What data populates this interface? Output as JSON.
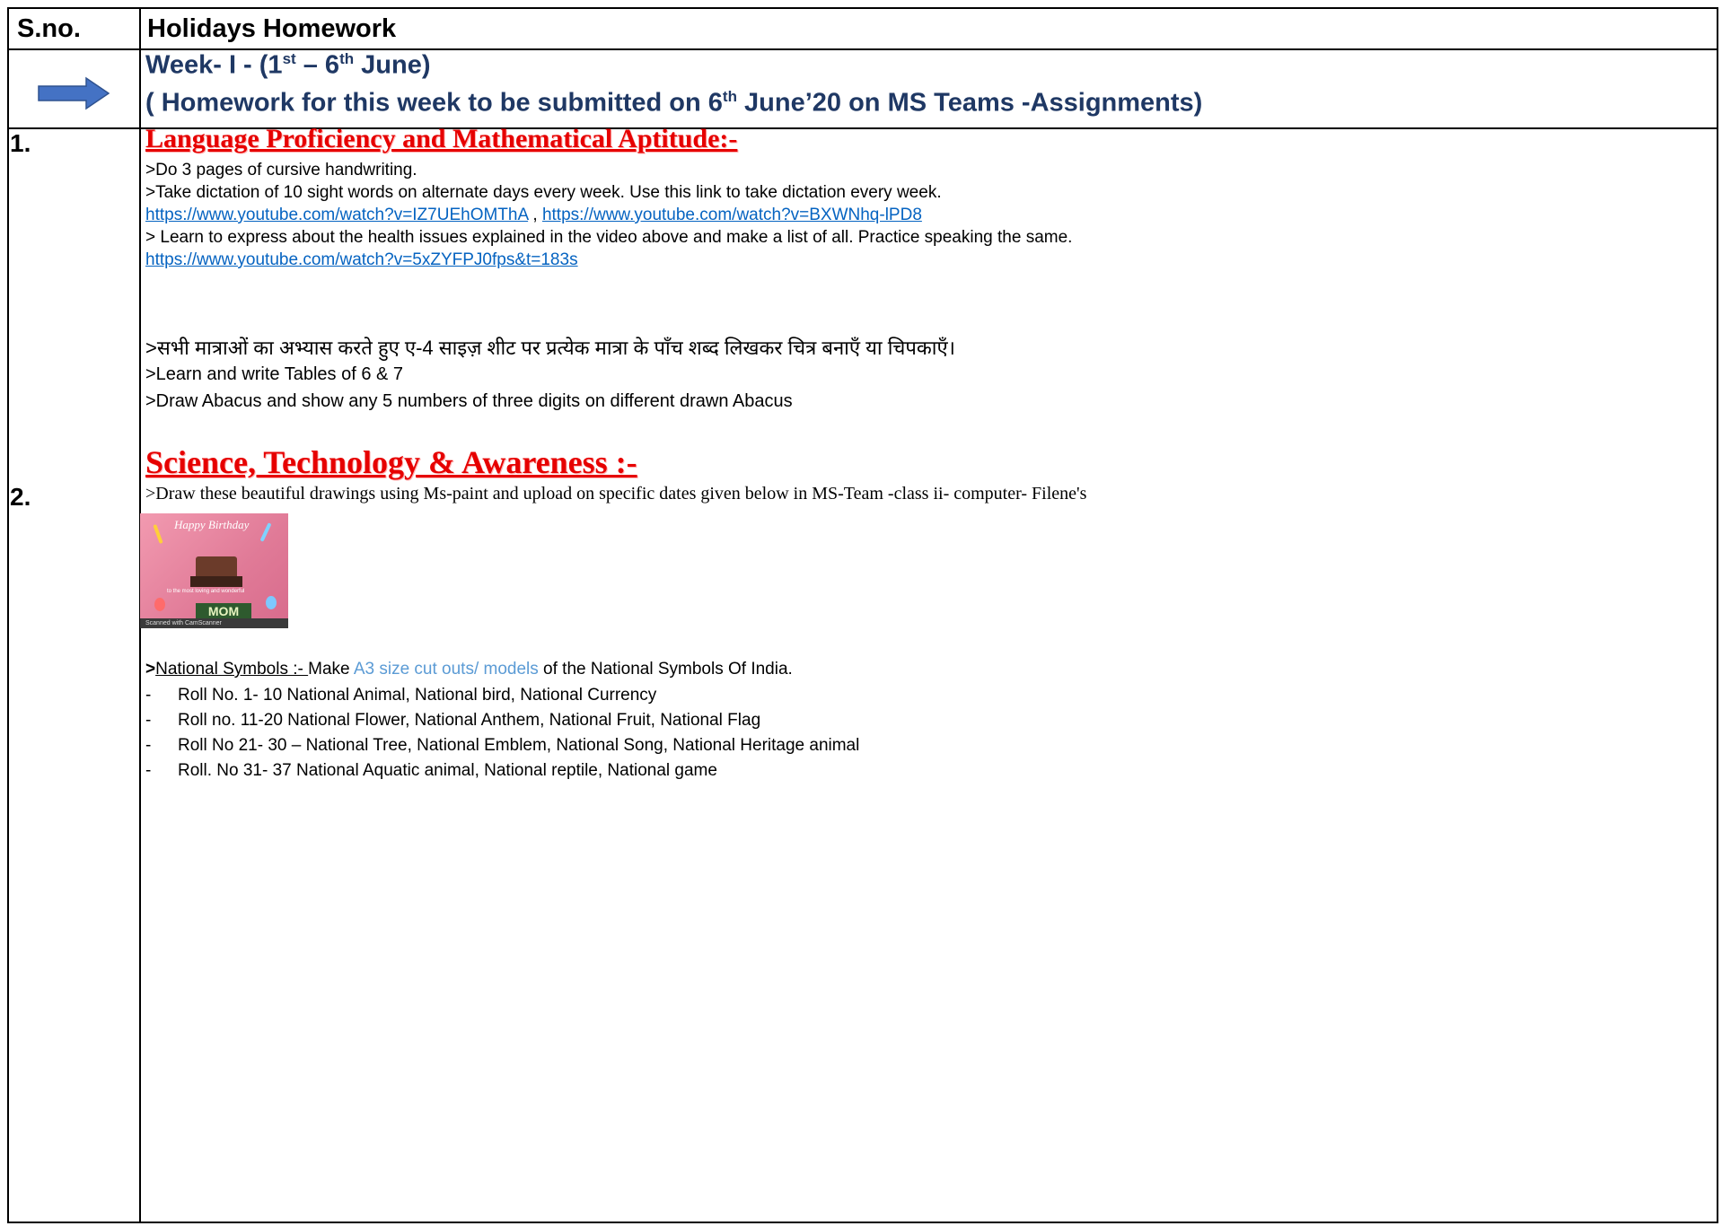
{
  "header": {
    "sno_label": "S.no.",
    "title": "Holidays Homework"
  },
  "week": {
    "line1_prefix": "Week- I  -  (1",
    "line1_sup1": "st",
    "line1_mid": "  – 6",
    "line1_sup2": "th",
    "line1_suffix": " June)",
    "line2_prefix": "( Homework for this week to be submitted on 6",
    "line2_sup": "th",
    "line2_suffix": " June’20 on MS Teams -Assignments)",
    "arrow_icon": "right-arrow-icon",
    "arrow_color": "#4472c4"
  },
  "section1": {
    "number": "1.",
    "title": "Language Proficiency and Mathematical Aptitude:-",
    "items": [
      ">Do 3 pages of cursive handwriting.",
      ">Take dictation of 10 sight words on alternate days every week. Use this link to take dictation every week.",
      "> Learn to express about the health issues explained in the video above and make a list of all. Practice speaking the same."
    ],
    "link1": "https://www.youtube.com/watch?v=IZ7UEhOMThA",
    "link_sep": " , ",
    "link2": "https://www.youtube.com/watch?v=BXWNhq-lPD8",
    "link3": "https://www.youtube.com/watch?v=5xZYFPJ0fps&t=183s",
    "hindi": ">सभी मात्राओं का अभ्यास करते हुए ए-4 साइज़ शीट पर प्रत्येक मात्रा के पाँच शब्द लिखकर चित्र बनाएँ या चिपकाएँ।",
    "math1": ">Learn and write Tables of 6 & 7",
    "math2": ">Draw Abacus and show any 5 numbers of three digits on different drawn Abacus"
  },
  "section2": {
    "number": "2.",
    "title": "Science, Technology & Awareness :-",
    "intro": ">Draw these beautiful drawings using Ms-paint and  upload on specific dates given below in MS-Team -class ii- computer- Filene's",
    "card": {
      "greeting": "Happy Birthday",
      "label": "MOM",
      "tagline": "to the most loving and wonderful",
      "footer": "Scanned with CamScanner"
    },
    "symbols_gt": ">",
    "symbols_label": "National Symbols :- ",
    "symbols_make": "Make ",
    "symbols_blue": "A3 size cut outs/ models",
    "symbols_rest": " of the National Symbols Of India.",
    "rolls": [
      "Roll No. 1- 10  National Animal, National bird, National Currency",
      "Roll no. 11-20 National Flower, National Anthem, National Fruit, National Flag",
      "Roll No 21- 30 – National Tree, National Emblem, National Song, National Heritage animal",
      "Roll. No 31- 37 National Aquatic animal, National reptile, National game"
    ],
    "dash": "-"
  }
}
